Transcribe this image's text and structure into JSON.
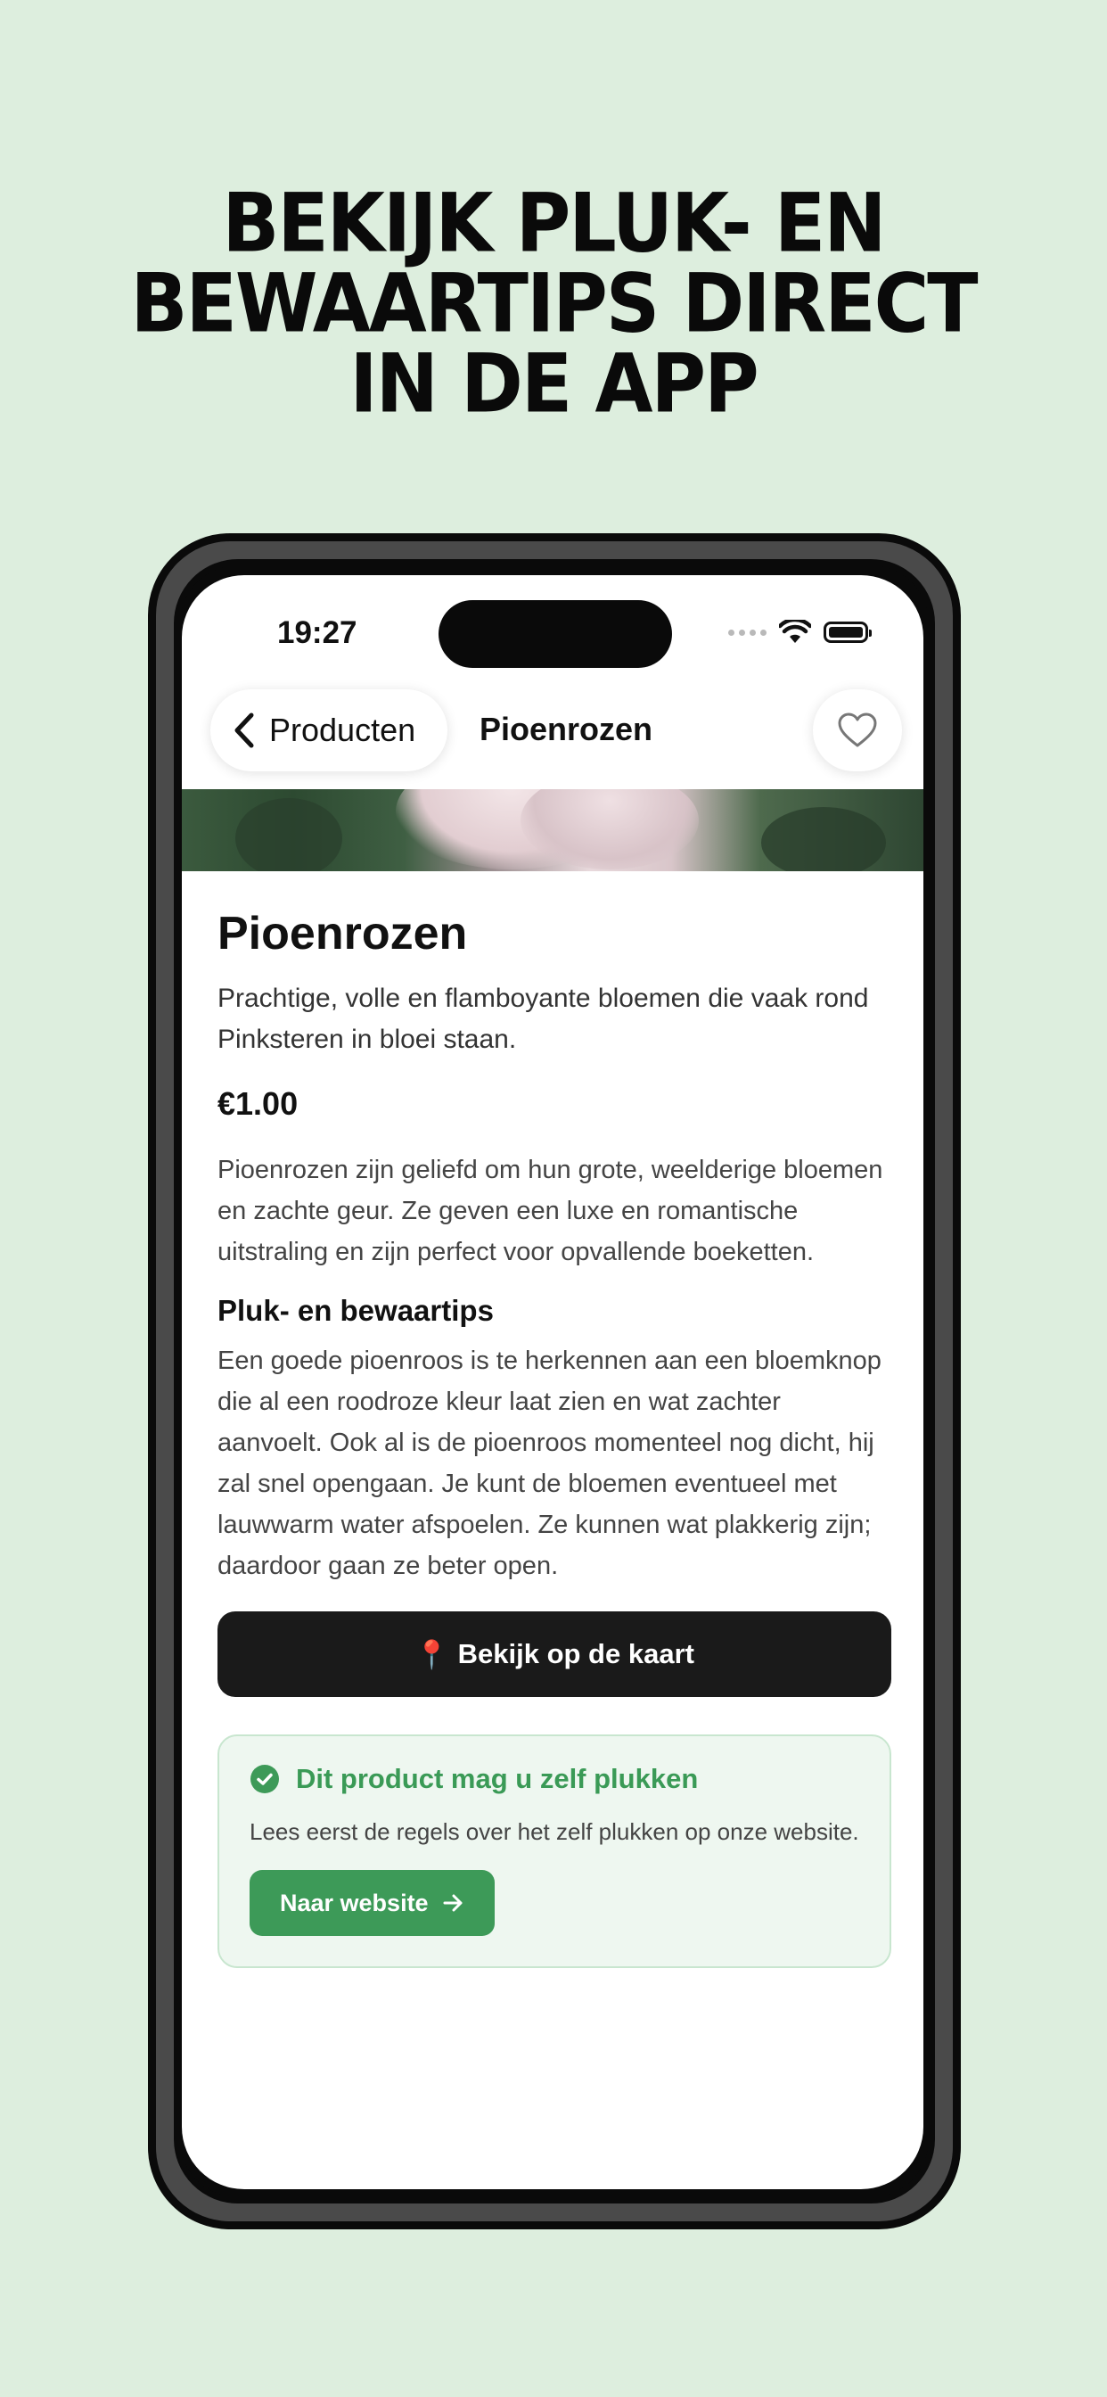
{
  "headline": [
    "BEKIJK PLUK- EN",
    "BEWAARTIPS DIRECT",
    "IN DE APP"
  ],
  "status_bar": {
    "time": "19:27"
  },
  "nav": {
    "back_label": "Producten",
    "title": "Pioenrozen"
  },
  "product": {
    "title": "Pioenrozen",
    "subtitle": "Prachtige, volle en flamboyante bloemen die vaak rond Pinksteren in bloei staan.",
    "price": "€1.00",
    "description": "Pioenrozen zijn geliefd om hun grote, weelderige bloemen en zachte geur. Ze geven een luxe en romantische uitstraling en zijn perfect voor opvallende boeketten.",
    "tips_title": "Pluk- en bewaartips",
    "tips_text": "Een goede pioenroos is te herkennen aan een bloemknop die al een roodroze kleur laat zien en wat zachter aanvoelt. Ook al is de pioenroos momenteel nog dicht, hij zal snel opengaan. Je kunt de bloemen eventueel met lauwwarm water afspoelen. Ze kunnen wat plakkerig zijn; daardoor gaan ze beter open.",
    "map_button": "Bekijk op de kaart",
    "map_button_icon": "📍"
  },
  "pick_box": {
    "title": "Dit product mag u zelf plukken",
    "text": "Lees eerst de regels over het zelf plukken op onze website.",
    "button": "Naar website"
  },
  "colors": {
    "background": "#ddeede",
    "accent_green": "#3d9a58",
    "dark_button": "#1a1a1a"
  }
}
